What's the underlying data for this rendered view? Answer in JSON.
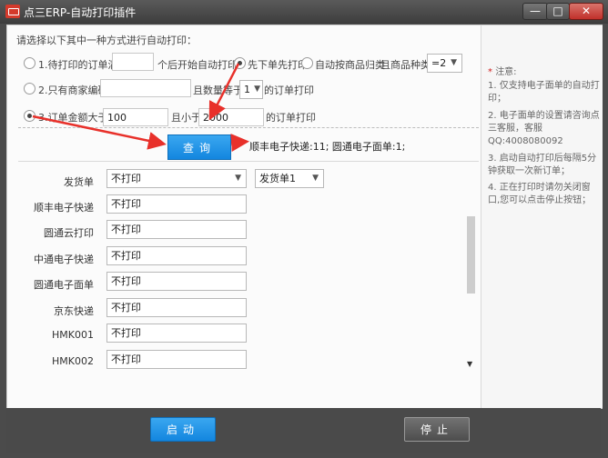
{
  "window": {
    "title": "点三ERP-自动打印插件",
    "minimize": "—",
    "maximize": "□",
    "close": "✕"
  },
  "instruction": "请选择以下其中一种方式进行自动打印：",
  "options": {
    "opt1": {
      "label": "1.待打印的订单满",
      "value": "",
      "suffix": "个后开始自动打印;",
      "radio_a_label": "先下单先打印",
      "radio_b_label": "自动按商品归类",
      "category_label": "且商品种类",
      "category_value": "=2"
    },
    "opt2": {
      "label": "2.只有商家编码",
      "value": "",
      "qty_label": "且数量等于",
      "qty_value": "1",
      "suffix": "的订单打印"
    },
    "opt3": {
      "label": "3.订单金额大于",
      "min_value": "100",
      "mid_label": "且小于",
      "max_value": "2000",
      "suffix": "的订单打印"
    },
    "selected": "opt3"
  },
  "query": {
    "button_label": "查询",
    "result": "顺丰电子快递:11; 圆通电子面单:1;"
  },
  "print_rows": [
    {
      "label": "发货单",
      "value": "不打印",
      "extra": "发货单1"
    },
    {
      "label": "顺丰电子快递",
      "value": "不打印"
    },
    {
      "label": "圆通云打印",
      "value": "不打印"
    },
    {
      "label": "中通电子快递",
      "value": "不打印"
    },
    {
      "label": "圆通电子面单",
      "value": "不打印"
    },
    {
      "label": "京东快递",
      "value": "不打印"
    },
    {
      "label": "HMK001",
      "value": "不打印"
    },
    {
      "label": "HMK002",
      "value": "不打印"
    }
  ],
  "notes": {
    "title": "注意:",
    "items": [
      "1. 仅支持电子面单的自动打印；",
      "2. 电子面单的设置请咨询点三客服，客服QQ:4008080092",
      "3. 启动自动打印后每隔5分钟获取一次新订单；",
      "4. 正在打印时请勿关闭窗口,您可以点击停止按钮；"
    ]
  },
  "footer": {
    "start_label": "启动",
    "stop_label": "停止"
  },
  "colors": {
    "accent": "#1a8ee6",
    "arrow": "#e8302a",
    "window": "#4b4b4b"
  }
}
